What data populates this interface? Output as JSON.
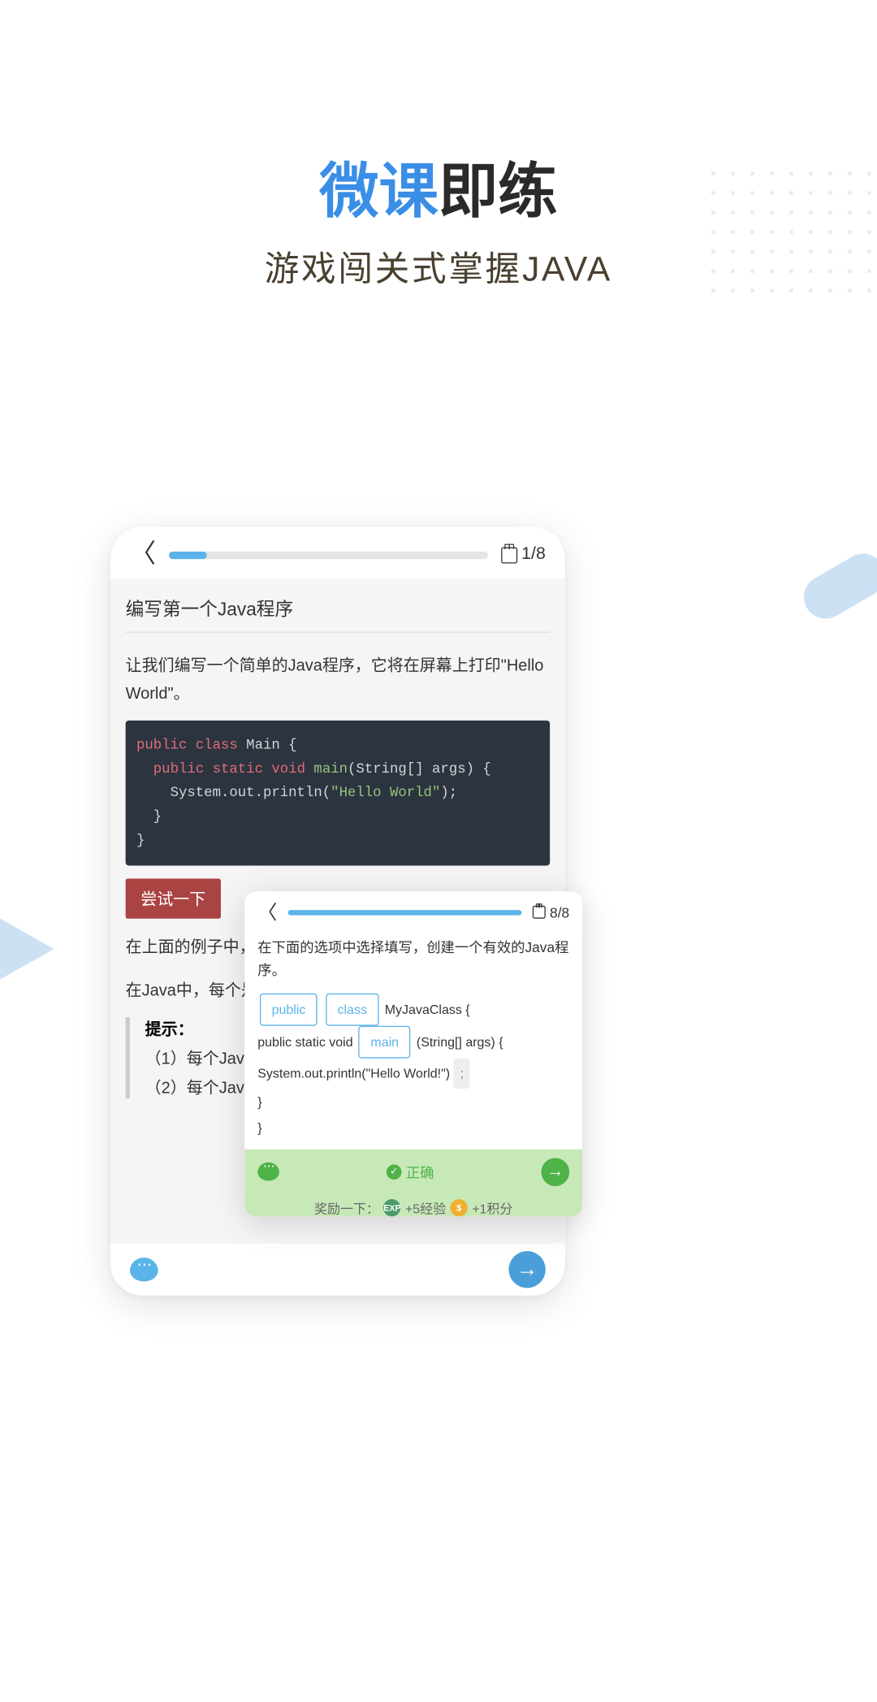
{
  "hero": {
    "title_accent": "微课",
    "title_rest": "即练",
    "subtitle": "游戏闯关式掌握JAVA"
  },
  "main": {
    "page_indicator": "1/8",
    "progress_percent": 12,
    "lesson_title": "编写第一个Java程序",
    "lesson_desc": "让我们编写一个简单的Java程序，它将在屏幕上打印\"Hello World\"。",
    "code": {
      "kw_public": "public",
      "kw_class": "class",
      "cls_name": " Main {",
      "kw_public2": "public",
      "kw_static": "static",
      "kw_void": "void",
      "fn_main": "main",
      "sig": "(String[] args) {",
      "print_head": "System.out.println(",
      "str": "\"Hello World\"",
      "print_tail": ");",
      "close1": "}",
      "close2": "}"
    },
    "try_label": "尝试一下",
    "body_text1": "在上面的例子中，中了解更多关于",
    "body_text2": "在Java中，每个是一个名为main",
    "hint_title": "提示：",
    "hint1": "（1）每个Jav",
    "hint2": "（2）每个Jav"
  },
  "overlay": {
    "page_indicator": "8/8",
    "progress_percent": 100,
    "question": "在下面的选项中选择填写，创建一个有效的Java程序。",
    "chip_public": "public",
    "chip_class": "class",
    "text_cls": " MyJavaClass {",
    "line2_prefix": "public static void ",
    "chip_main": "main",
    "line2_suffix": " (String[] args) {",
    "line3_prefix": " System.out.println(\"Hello World!\") ",
    "chip_semi": ";",
    "close1": "}",
    "close2": "}",
    "correct_label": "正确",
    "reward_prefix": "奖励一下：",
    "exp_text": "+5经验",
    "coin_text": "+1积分",
    "exp_badge": "EXP",
    "coin_badge": "$"
  }
}
